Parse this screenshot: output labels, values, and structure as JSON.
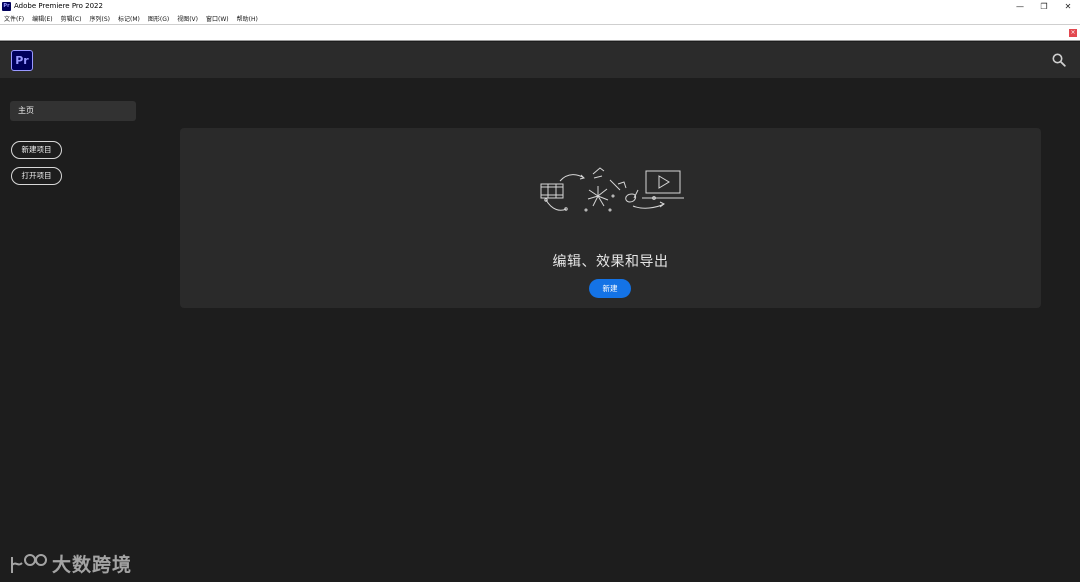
{
  "window": {
    "title": "Adobe Premiere Pro 2022",
    "app_icon_text": "Pr",
    "controls": {
      "minimize": "—",
      "restore": "❐",
      "close": "✕"
    }
  },
  "menubar": {
    "items": [
      "文件(F)",
      "编辑(E)",
      "剪辑(C)",
      "序列(S)",
      "标记(M)",
      "图形(G)",
      "视图(V)",
      "窗口(W)",
      "帮助(H)"
    ]
  },
  "notification": {
    "close_label": "×",
    "color": "#e34850"
  },
  "header": {
    "logo_text": "Pr",
    "search_icon": "search-icon"
  },
  "sidebar": {
    "home_label": "主页",
    "new_project_label": "新建项目",
    "open_project_label": "打开项目"
  },
  "main": {
    "headline": "编辑、效果和导出",
    "new_button_label": "新建",
    "accent_color": "#1473e6"
  },
  "watermark": {
    "text": "大数跨境"
  }
}
